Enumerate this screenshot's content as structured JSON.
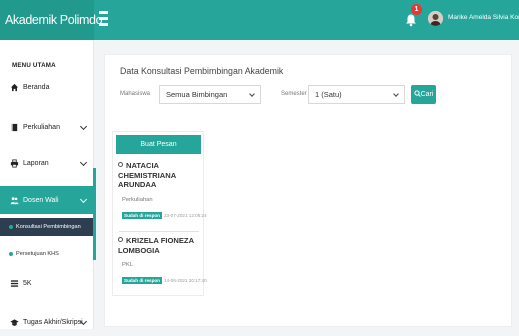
{
  "app": {
    "title": "Akademik Polimdo",
    "notification_count": "1",
    "user_name": "Marike Amelda Silvia Kondoj, SST.,MT"
  },
  "sidebar": {
    "section_title": "MENU UTAMA",
    "items": [
      {
        "label": "Beranda",
        "icon": "home-icon"
      },
      {
        "label": "Perkuliahan",
        "icon": "book-icon"
      },
      {
        "label": "Laporan",
        "icon": "printer-icon"
      },
      {
        "label": "Dosen Wali",
        "icon": "users-icon"
      },
      {
        "label": "5K",
        "icon": "list-icon"
      },
      {
        "label": "Tugas Akhir/Skripsi",
        "icon": "graduation-cap-icon"
      }
    ],
    "subitems": [
      {
        "label": "Konsultasi Pembimbingan"
      },
      {
        "label": "Persetujuan KHS"
      }
    ]
  },
  "main": {
    "title": "Data Konsultasi Pembimbingan Akademik",
    "filters": {
      "mahasiswa_label": "Mahasiswa",
      "mahasiswa_value": "Semua Bimbingan",
      "semester_label": "Semester",
      "semester_value": "1 (Satu)",
      "search_button": "Cari"
    },
    "new_message_button": "Buat Pesan",
    "consultations": [
      {
        "name": "NATACIA CHEMISTRIANA ARUNDAA",
        "category": "Perkuliahan",
        "status": "Sudah di respon",
        "timestamp": "23-07-2021 12:06:24"
      },
      {
        "name": "KRIZELA FIONEZA LOMBOGIA",
        "category": "PKL",
        "status": "Sudah di respon",
        "timestamp": "14-06-2021 20:17:40"
      }
    ]
  },
  "colors": {
    "accent": "#26a69a",
    "submenu_bg": "#2c3e50",
    "badge": "#e53935"
  }
}
